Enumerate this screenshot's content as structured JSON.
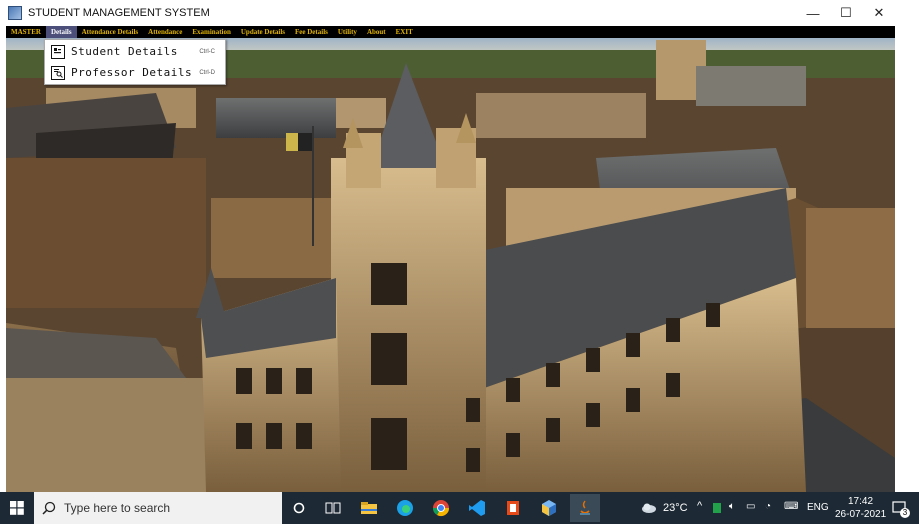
{
  "window": {
    "title": "STUDENT MANAGEMENT SYSTEM",
    "controls": {
      "minimize": "—",
      "maximize": "☐",
      "close": "✕"
    }
  },
  "menubar": {
    "items": [
      {
        "label": "MASTER"
      },
      {
        "label": "Details",
        "active": true
      },
      {
        "label": "Attendance Details"
      },
      {
        "label": "Attendance"
      },
      {
        "label": "Examination"
      },
      {
        "label": "Update Details"
      },
      {
        "label": "Fee Details"
      },
      {
        "label": "Utility"
      },
      {
        "label": "About"
      },
      {
        "label": "EXIT"
      }
    ]
  },
  "dropdown": {
    "items": [
      {
        "label": "Student Details",
        "shortcut": "Ctrl-C",
        "icon": "id-card-icon"
      },
      {
        "label": "Professor Details",
        "shortcut": "Ctrl-D",
        "icon": "document-search-icon"
      }
    ]
  },
  "taskbar": {
    "search_placeholder": "Type here to search",
    "weather": "23°C",
    "language": "ENG",
    "time": "17:42",
    "date": "26-07-2021",
    "notification_count": "3",
    "apps": [
      "task-view-icon",
      "file-explorer-icon",
      "edge-icon",
      "chrome-icon",
      "vscode-icon",
      "office-icon",
      "3d-viewer-icon",
      "java-app-icon"
    ]
  }
}
